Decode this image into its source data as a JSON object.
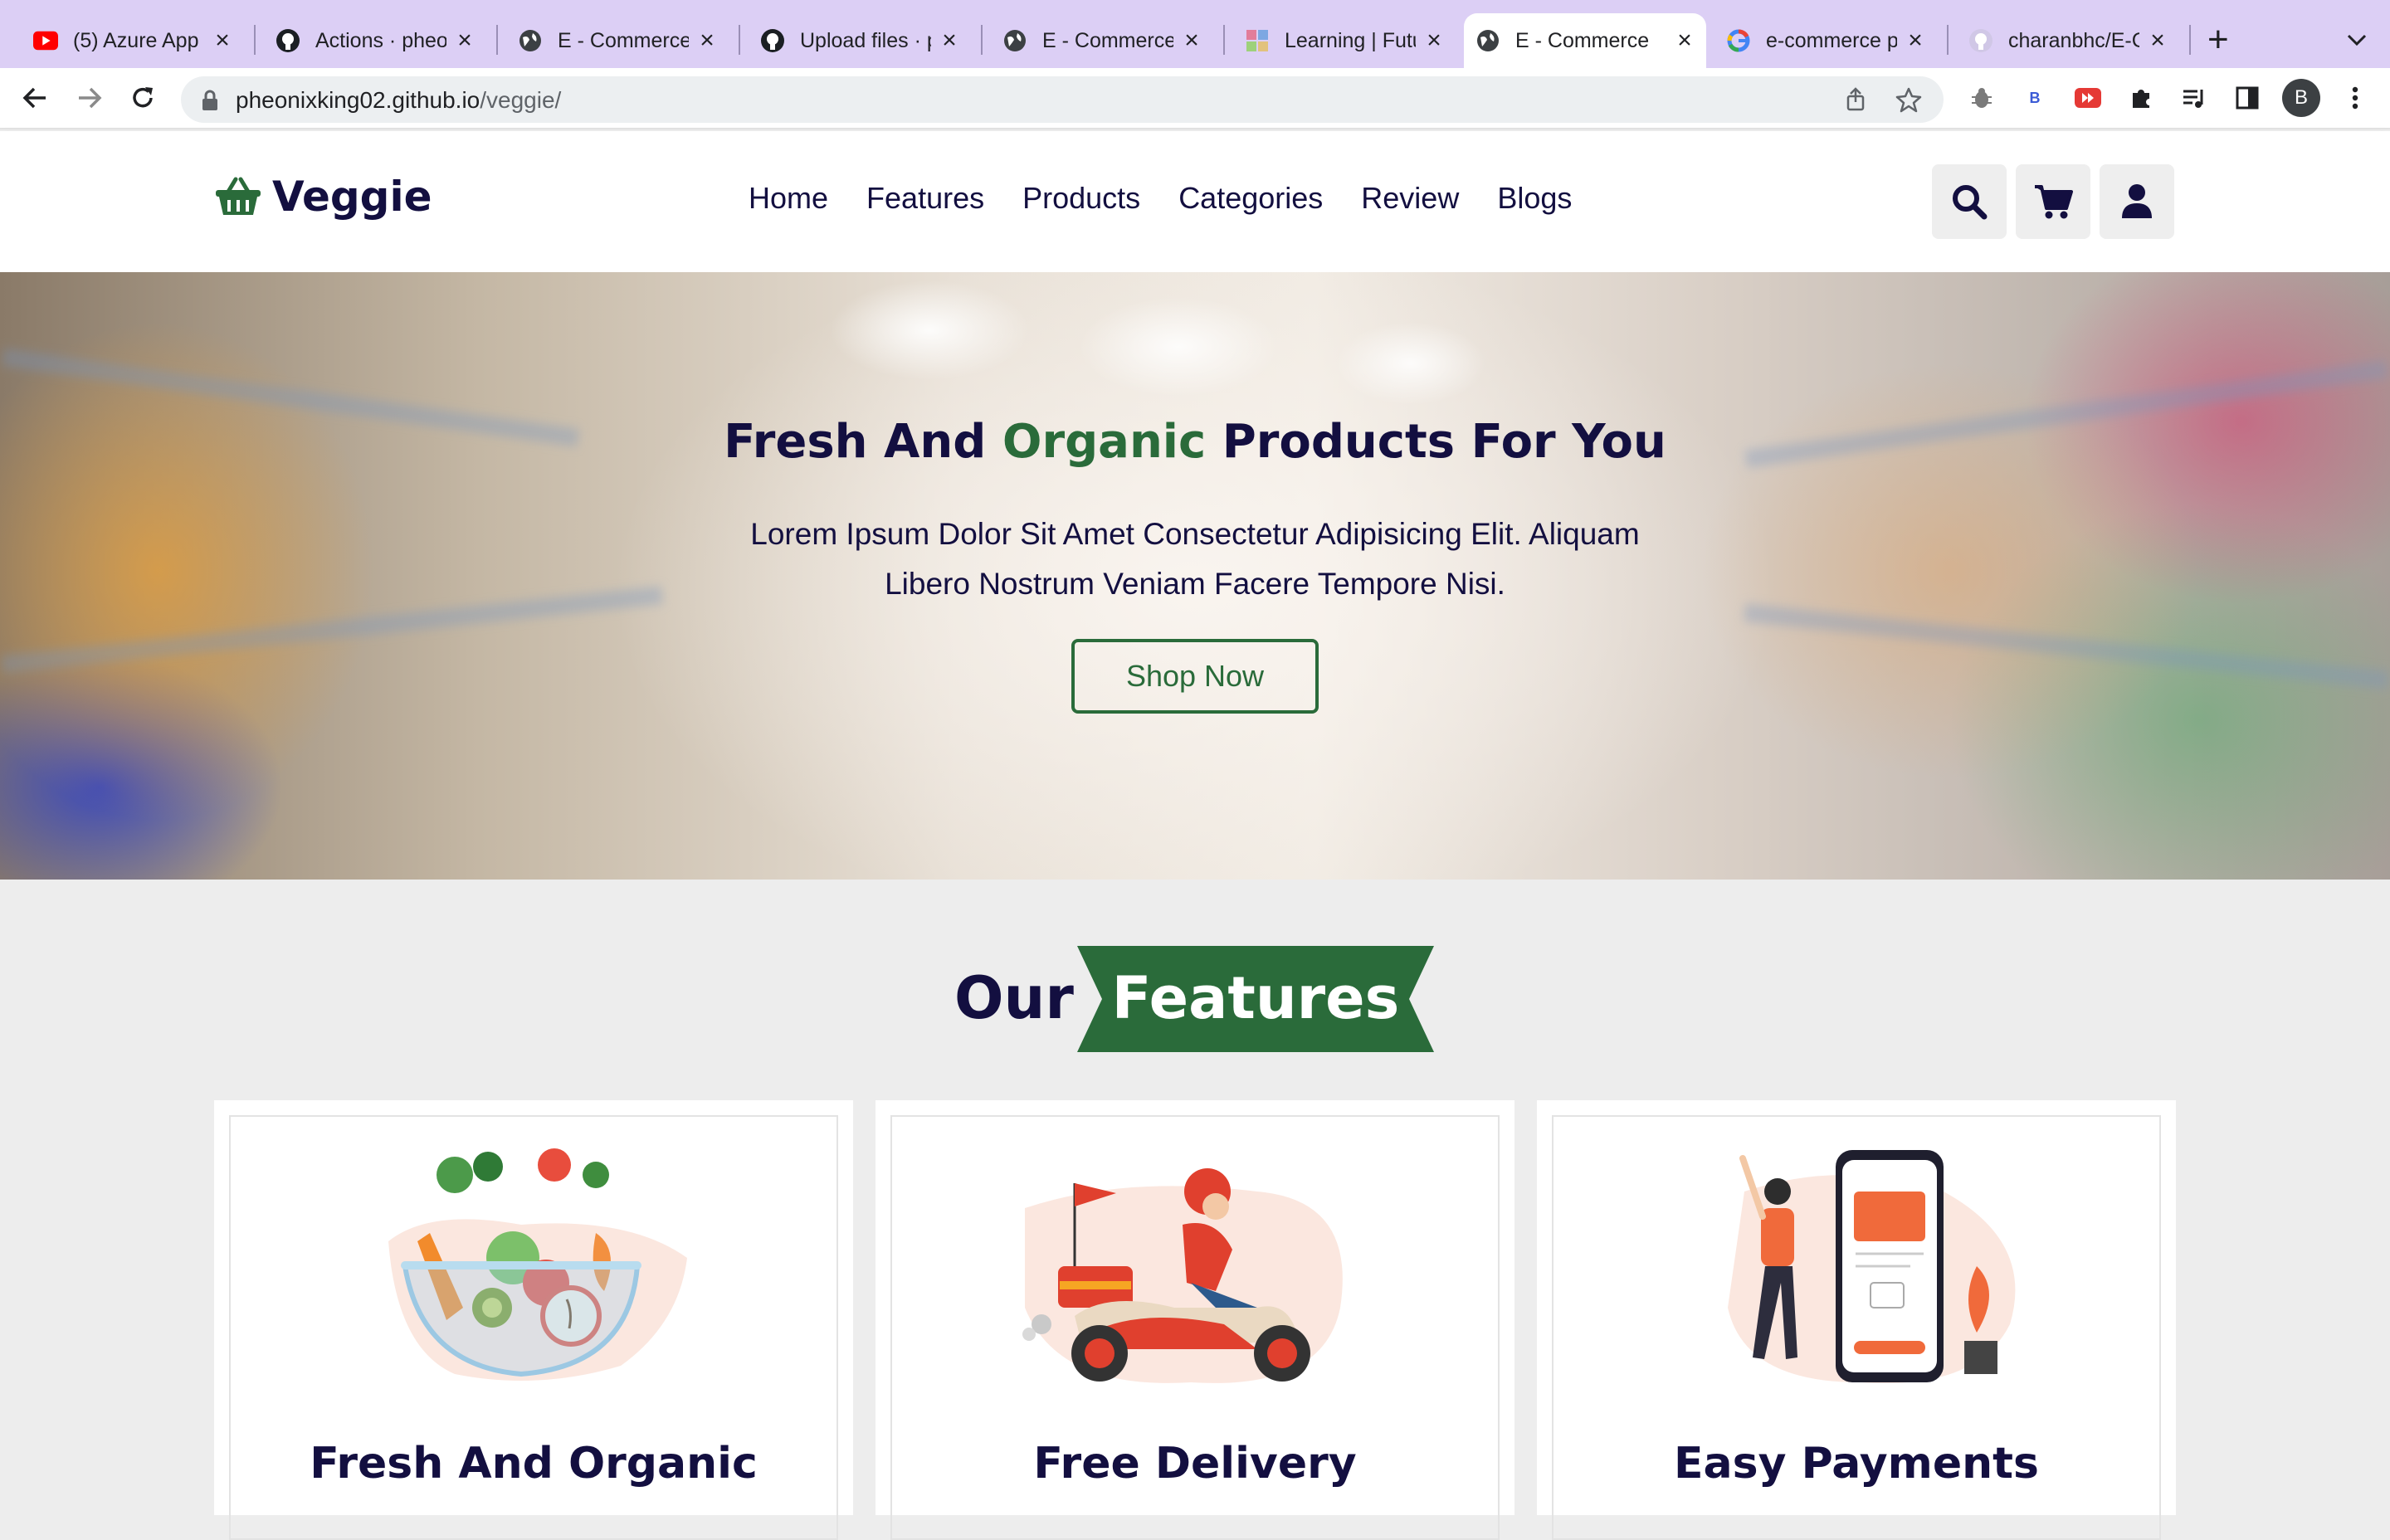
{
  "browser": {
    "tabs": [
      {
        "title": "(5) Azure App",
        "icon": "youtube-icon",
        "active": false
      },
      {
        "title": "Actions · pheo",
        "icon": "github-icon",
        "active": false
      },
      {
        "title": "E - Commerce",
        "icon": "globe-icon",
        "active": false
      },
      {
        "title": "Upload files · p",
        "icon": "github-icon",
        "active": false
      },
      {
        "title": "E - Commerce",
        "icon": "globe-icon",
        "active": false
      },
      {
        "title": "Learning | Futu",
        "icon": "learning-icon",
        "active": false
      },
      {
        "title": "E - Commerce",
        "icon": "globe-icon",
        "active": true
      },
      {
        "title": "e-commerce p",
        "icon": "google-icon",
        "active": false
      },
      {
        "title": "charanbhc/E-C",
        "icon": "github-icon",
        "active": false
      }
    ],
    "url_host": "pheonixking02.github.io",
    "url_path": "/veggie/",
    "profile_initial": "B",
    "extension_badge": "B"
  },
  "site": {
    "brand": "Veggie",
    "nav": [
      "Home",
      "Features",
      "Products",
      "Categories",
      "Review",
      "Blogs"
    ],
    "colors": {
      "primary": "#130f40",
      "accent": "#2a6b3a"
    }
  },
  "hero": {
    "title_part1": "Fresh And ",
    "title_accent": "Organic",
    "title_part2": " Products For You",
    "text": "Lorem Ipsum Dolor Sit Amet Consectetur Adipisicing Elit. Aliquam Libero Nostrum Veniam Facere Tempore Nisi.",
    "button": "Shop Now"
  },
  "features": {
    "heading_plain": "Our",
    "heading_ribbon": "Features",
    "cards": [
      {
        "title": "Fresh And Organic",
        "image": "vegetable-bowl-illustration"
      },
      {
        "title": "Free Delivery",
        "image": "delivery-scooter-illustration"
      },
      {
        "title": "Easy Payments",
        "image": "mobile-payment-illustration"
      }
    ]
  }
}
